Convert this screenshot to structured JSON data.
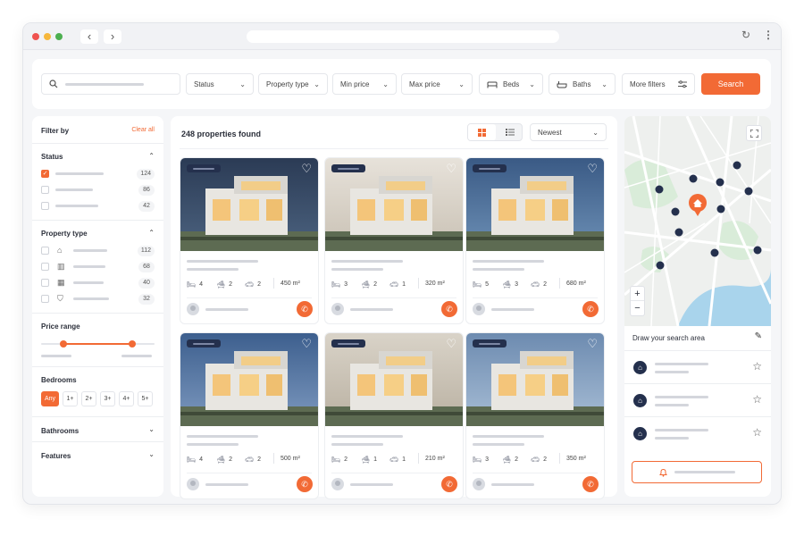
{
  "colors": {
    "accent": "#f26a35",
    "navy": "#24304d",
    "muted": "#d4d6dc"
  },
  "browser": {
    "back_icon": "chevron-left-icon",
    "forward_icon": "chevron-right-icon",
    "reload_icon": "reload-icon",
    "menu_icon": "kebab-menu-icon"
  },
  "search_bar": {
    "status_label": "Status",
    "property_type_label": "Property type",
    "min_price_label": "Min price",
    "max_price_label": "Max price",
    "beds_label": "Beds",
    "baths_label": "Baths",
    "more_filters_label": "More filters",
    "search_button_label": "Search"
  },
  "filter": {
    "title": "Filter by",
    "clear_all": "Clear all",
    "status_title": "Status",
    "status_counts": [
      "124",
      "86",
      "42"
    ],
    "property_type_title": "Property type",
    "property_type_counts": [
      "112",
      "68",
      "40",
      "32"
    ],
    "price_range_title": "Price range",
    "price_range_low": 0.2,
    "price_range_high": 0.8,
    "bedrooms_title": "Bedrooms",
    "bedroom_options": [
      "Any",
      "1+",
      "2+",
      "3+",
      "4+",
      "5+"
    ],
    "bathrooms_title": "Bathrooms",
    "features_title": "Features"
  },
  "results": {
    "count_label": "248 properties found",
    "sort_value": "Newest",
    "cards": [
      {
        "beds": "4",
        "baths": "2",
        "garage": "2",
        "area": "450 m²"
      },
      {
        "beds": "3",
        "baths": "2",
        "garage": "1",
        "area": "320 m²"
      },
      {
        "beds": "5",
        "baths": "3",
        "garage": "2",
        "area": "680 m²"
      },
      {
        "beds": "4",
        "baths": "2",
        "garage": "2",
        "area": "500 m²"
      },
      {
        "beds": "2",
        "baths": "1",
        "garage": "1",
        "area": "210 m²"
      },
      {
        "beds": "3",
        "baths": "2",
        "garage": "2",
        "area": "350 m²"
      }
    ]
  },
  "map": {
    "draw_label": "Draw your search area",
    "zoom_in": "+",
    "zoom_out": "−"
  }
}
